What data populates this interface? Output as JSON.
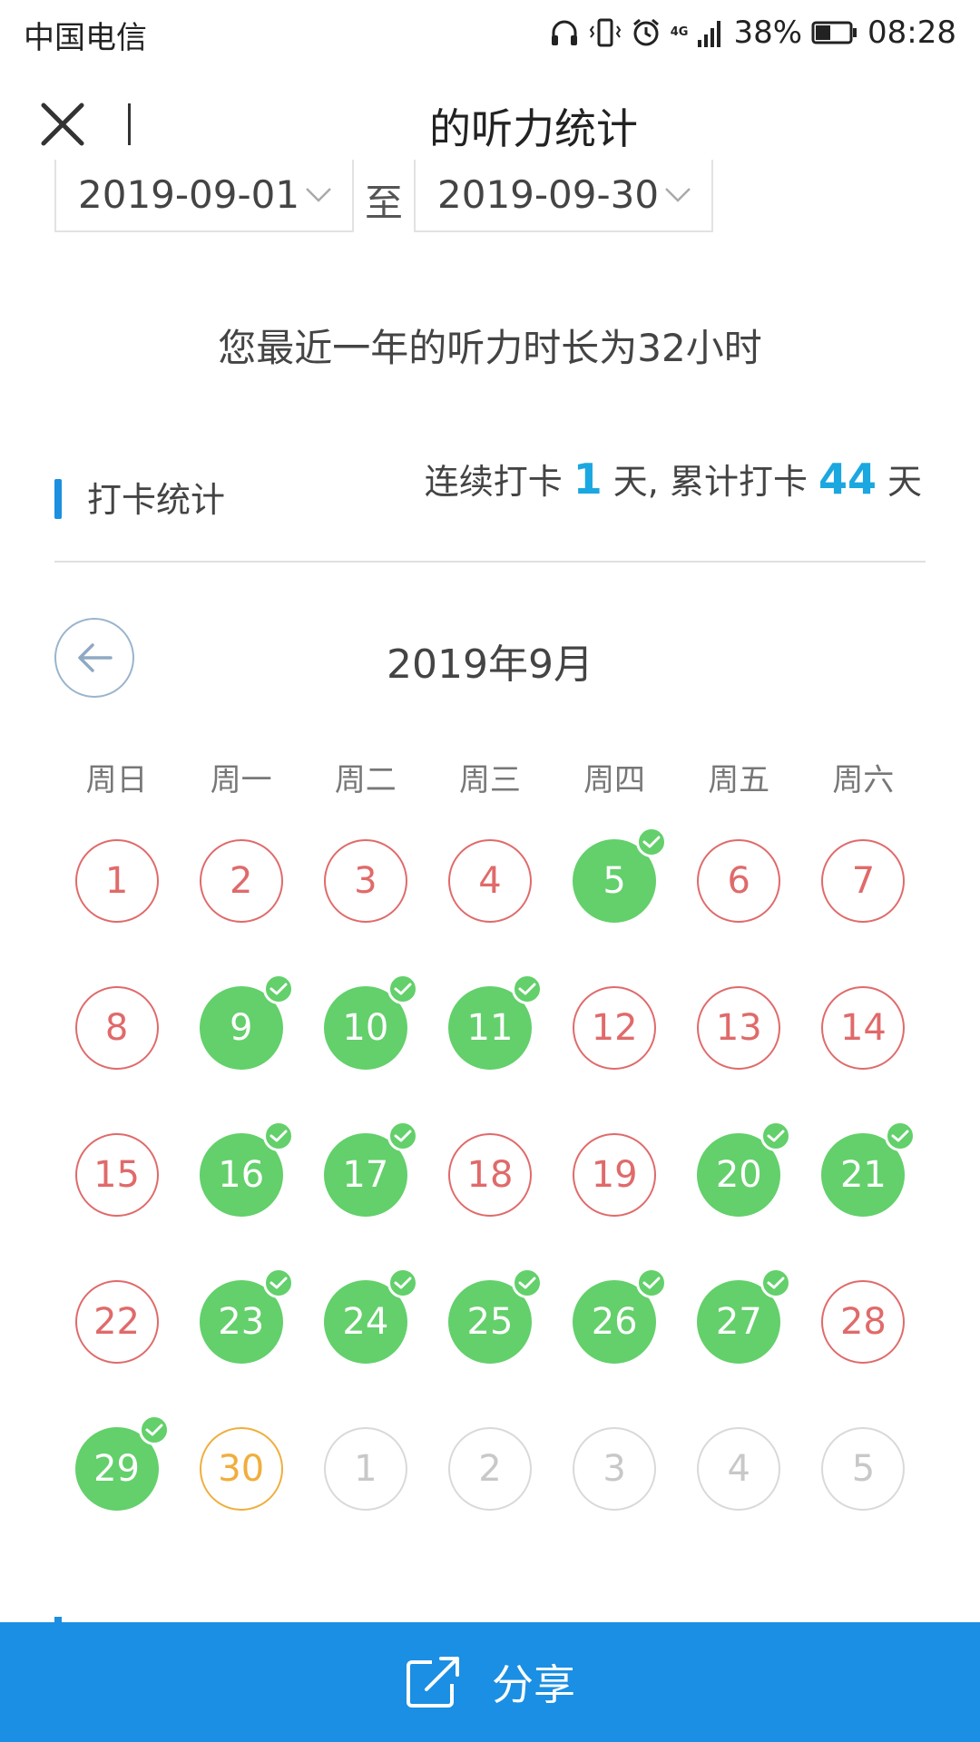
{
  "status_bar": {
    "carrier": "中国电信",
    "network": "4G",
    "battery": "38%",
    "time": "08:28"
  },
  "header": {
    "title": "的听力统计"
  },
  "date_range": {
    "from": "2019-09-01",
    "separator": "至",
    "to": "2019-09-30"
  },
  "summary": "您最近一年的听力时长为32小时",
  "checkin": {
    "section_title": "打卡统计",
    "streak_prefix": "连续打卡",
    "streak_days": "1",
    "streak_mid": "天, 累计打卡",
    "total_days": "44",
    "streak_suffix": "天"
  },
  "calendar": {
    "month_title": "2019年9月",
    "weekdays": [
      "周日",
      "周一",
      "周二",
      "周三",
      "周四",
      "周五",
      "周六"
    ],
    "days": [
      {
        "label": "1",
        "state": "missed"
      },
      {
        "label": "2",
        "state": "missed"
      },
      {
        "label": "3",
        "state": "missed"
      },
      {
        "label": "4",
        "state": "missed"
      },
      {
        "label": "5",
        "state": "done"
      },
      {
        "label": "6",
        "state": "missed"
      },
      {
        "label": "7",
        "state": "missed"
      },
      {
        "label": "8",
        "state": "missed"
      },
      {
        "label": "9",
        "state": "done"
      },
      {
        "label": "10",
        "state": "done"
      },
      {
        "label": "11",
        "state": "done"
      },
      {
        "label": "12",
        "state": "missed"
      },
      {
        "label": "13",
        "state": "missed"
      },
      {
        "label": "14",
        "state": "missed"
      },
      {
        "label": "15",
        "state": "missed"
      },
      {
        "label": "16",
        "state": "done"
      },
      {
        "label": "17",
        "state": "done"
      },
      {
        "label": "18",
        "state": "missed"
      },
      {
        "label": "19",
        "state": "missed"
      },
      {
        "label": "20",
        "state": "done"
      },
      {
        "label": "21",
        "state": "done"
      },
      {
        "label": "22",
        "state": "missed"
      },
      {
        "label": "23",
        "state": "done"
      },
      {
        "label": "24",
        "state": "done"
      },
      {
        "label": "25",
        "state": "done"
      },
      {
        "label": "26",
        "state": "done"
      },
      {
        "label": "27",
        "state": "done"
      },
      {
        "label": "28",
        "state": "missed"
      },
      {
        "label": "29",
        "state": "done"
      },
      {
        "label": "30",
        "state": "today"
      },
      {
        "label": "1",
        "state": "next"
      },
      {
        "label": "2",
        "state": "next"
      },
      {
        "label": "3",
        "state": "next"
      },
      {
        "label": "4",
        "state": "next"
      },
      {
        "label": "5",
        "state": "next"
      }
    ]
  },
  "share": {
    "label": "分享"
  },
  "colors": {
    "accent_blue": "#1a8fe3",
    "done_green": "#63d06b",
    "missed_red": "#e06a6a",
    "today_orange": "#f0ae3c"
  }
}
